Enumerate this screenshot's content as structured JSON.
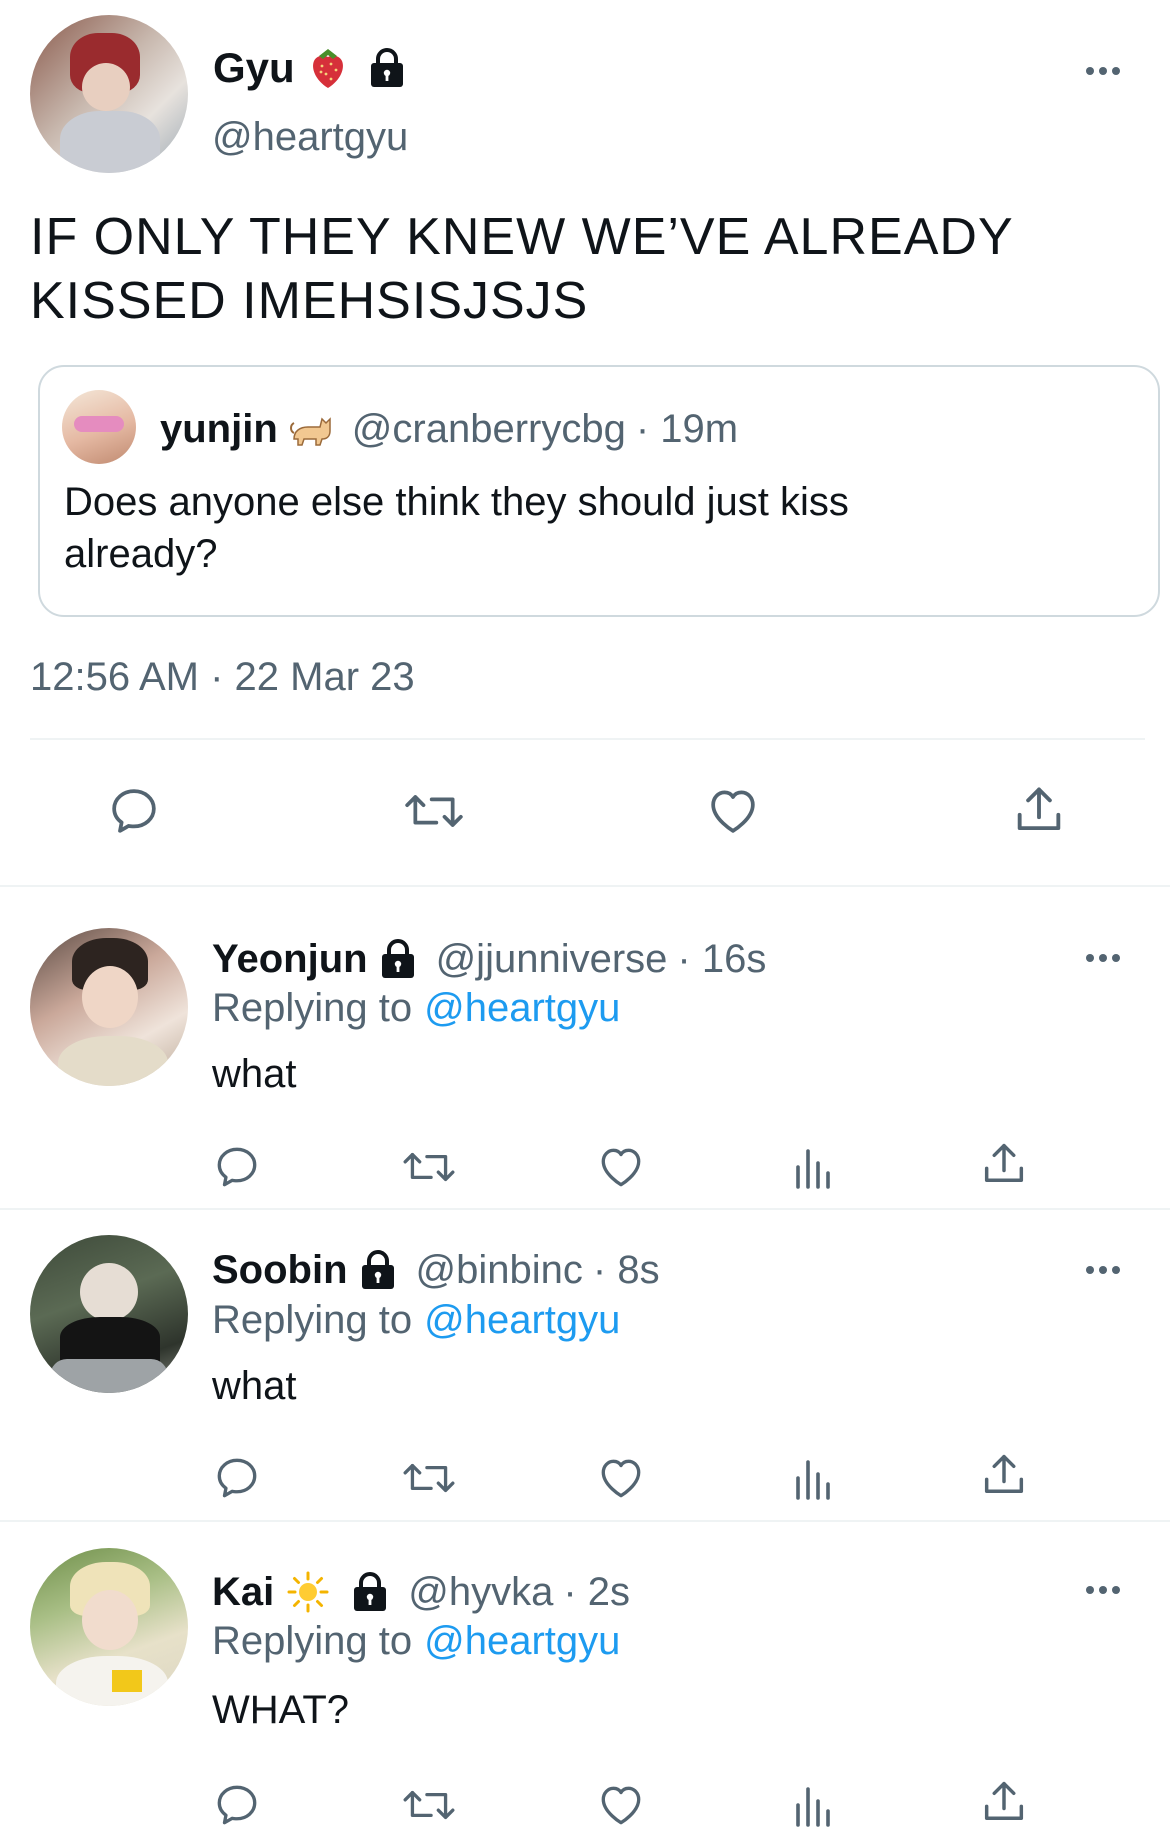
{
  "main_tweet": {
    "author": {
      "name": "Gyu",
      "handle": "@heartgyu",
      "emoji": "strawberry-icon",
      "locked": true
    },
    "text_line1": "IF ONLY THEY KNEW WE’VE ALREADY",
    "text_line2": "KISSED IMEHSISJSJS",
    "quote": {
      "name": "yunjin",
      "emoji": "cat-icon",
      "handle": "@cranberrycbg",
      "time": "· 19m",
      "text_line1": "Does anyone else think they should just kiss",
      "text_line2": "already?"
    },
    "timestamp": "12:56 AM · 22 Mar 23"
  },
  "replies": [
    {
      "name": "Yeonjun",
      "handle": "@jjunniverse",
      "time": "· 16s",
      "replying_label": "Replying to",
      "replying_handle": "@heartgyu",
      "text": "what",
      "locked": true,
      "emoji": ""
    },
    {
      "name": "Soobin",
      "handle": "@binbinc",
      "time": "· 8s",
      "replying_label": "Replying to",
      "replying_handle": "@heartgyu",
      "text": "what",
      "locked": true,
      "emoji": ""
    },
    {
      "name": "Kai",
      "handle": "@hyvka",
      "time": "· 2s",
      "replying_label": "Replying to",
      "replying_handle": "@heartgyu",
      "text": "WHAT?",
      "locked": true,
      "emoji": "sun-icon"
    }
  ],
  "colors": {
    "accent": "#1d9bf0",
    "text": "#0f1419",
    "secondary": "#536471",
    "divider": "#eff3f4"
  }
}
